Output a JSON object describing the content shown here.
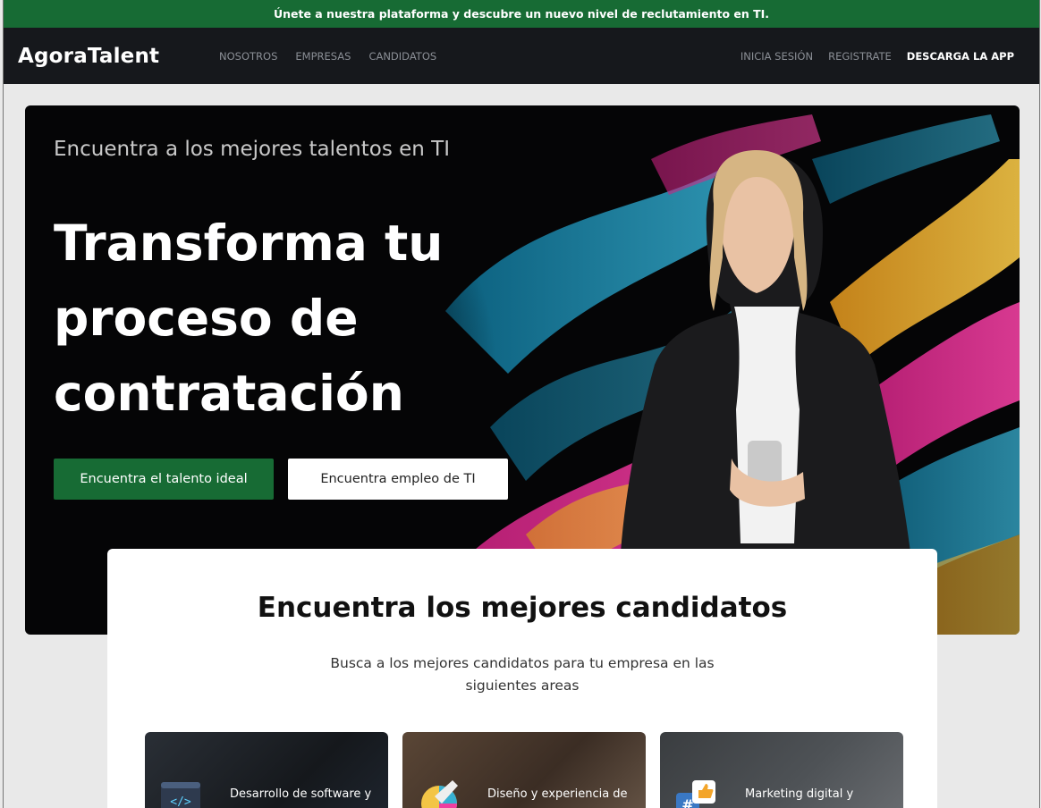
{
  "announcement": "Únete a nuestra plataforma y descubre un nuevo nivel de reclutamiento en TI.",
  "brand": {
    "logo": "AgoraTalent"
  },
  "nav": {
    "links": [
      "NOSOTROS",
      "EMPRESAS",
      "CANDIDATOS"
    ],
    "login": "INICIA SESIÓN",
    "register": "REGISTRATE",
    "download": "DESCARGA LA APP"
  },
  "hero": {
    "eyebrow": "Encuentra a los mejores talentos en TI",
    "headline": "Transforma tu proceso de contratación",
    "primary_cta": "Encuentra el talento ideal",
    "secondary_cta": "Encuentra empleo de TI"
  },
  "section": {
    "title": "Encuentra los mejores candidatos",
    "subtitle": "Busca a los mejores candidatos para tu empresa en las siguientes areas"
  },
  "categories": [
    {
      "label": "Desarrollo de software y",
      "icon": "code-icon"
    },
    {
      "label": "Diseño y experiencia de",
      "icon": "design-pen-icon"
    },
    {
      "label": "Marketing digital y",
      "icon": "social-like-icon"
    }
  ],
  "colors": {
    "brand_green": "#176b34",
    "nav_bg": "#16181c",
    "hero_bg": "#050506"
  }
}
